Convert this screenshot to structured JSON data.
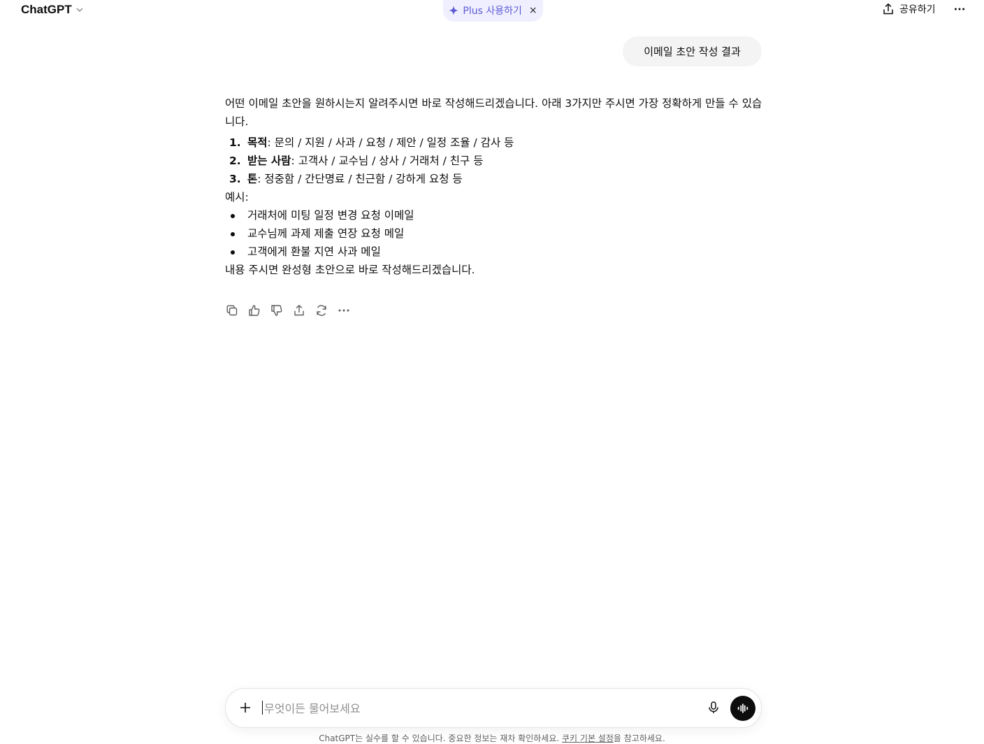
{
  "header": {
    "model_name": "ChatGPT",
    "upgrade_label": "Plus 사용하기",
    "upgrade_close": "×",
    "share_label": "공유하기"
  },
  "conversation": {
    "user_message": "이메일 초안 작성 결과",
    "assistant": {
      "intro": "어떤 이메일 초안을 원하시는지 알려주시면 바로 작성해드리겠습니다. 아래 3가지만 주시면 가장 정확하게 만들 수 있습니다.",
      "numbered": [
        {
          "num": "1.",
          "label": "목적",
          "text": ": 문의 / 지원 / 사과 / 요청 / 제안 / 일정 조율 / 감사 등"
        },
        {
          "num": "2.",
          "label": "받는 사람",
          "text": ": 고객사 / 교수님 / 상사 / 거래처 / 친구 등"
        },
        {
          "num": "3.",
          "label": "톤",
          "text": ": 정중함 / 간단명료 / 친근함 / 강하게 요청 등"
        }
      ],
      "example_label": "예시:",
      "examples": [
        "거래처에 미팅 일정 변경 요청 이메일",
        "교수님께 과제 제출 연장 요청 메일",
        "고객에게 환불 지연 사과 메일"
      ],
      "closing": "내용 주시면 완성형 초안으로 바로 작성해드리겠습니다."
    },
    "action_icons": [
      "copy-icon",
      "thumbs-up-icon",
      "thumbs-down-icon",
      "share-icon",
      "regenerate-icon",
      "more-icon"
    ]
  },
  "composer": {
    "placeholder": "무엇이든 물어보세요"
  },
  "footer": {
    "note_prefix": "ChatGPT는 실수를 할 수 있습니다. 중요한 정보는 재차 확인하세요. ",
    "cookie_link": "쿠키 기본 설정",
    "note_suffix": "을 참고하세요."
  },
  "colors": {
    "accent": "#5d5bd4",
    "pill_bg": "#f0efff",
    "bubble_bg": "#f4f4f4",
    "text": "#0d0d0d"
  }
}
